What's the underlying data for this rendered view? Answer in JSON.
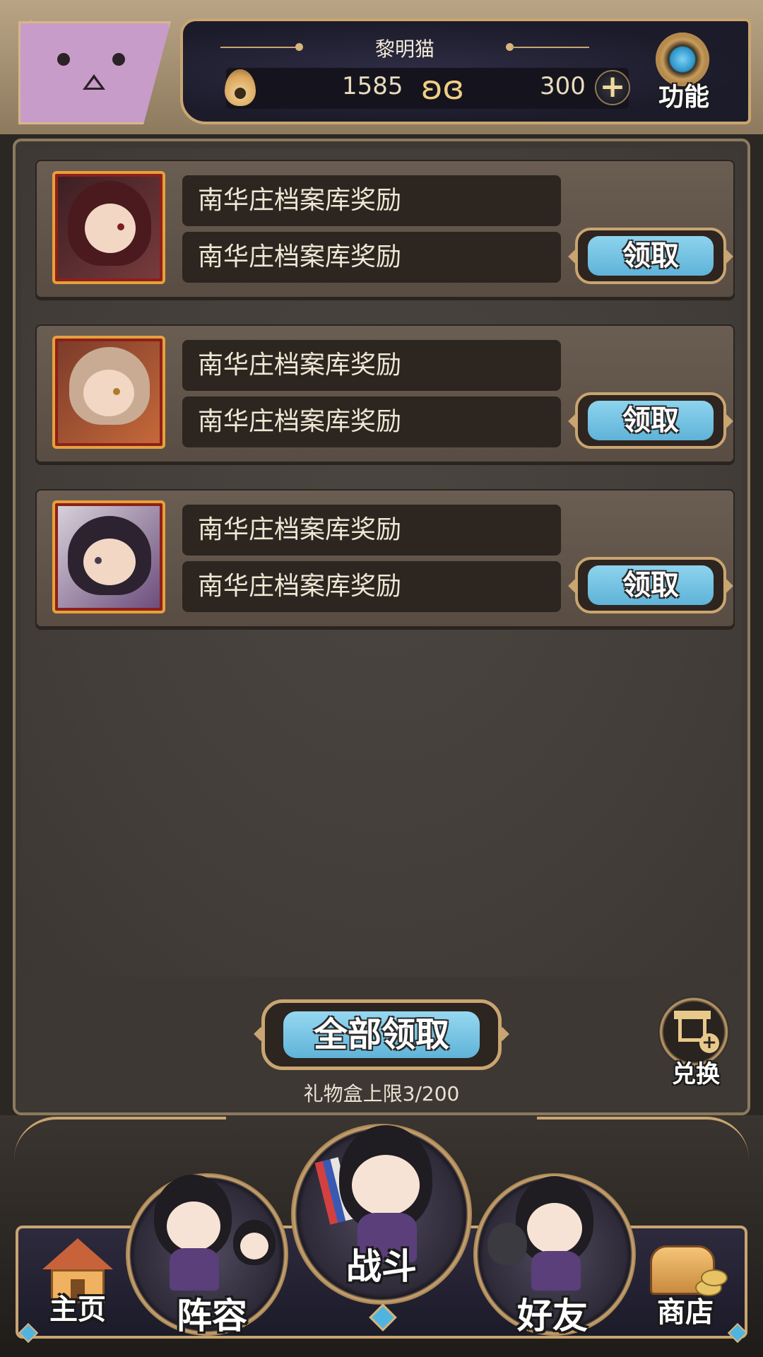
{
  "header": {
    "player_name": "黎明猫",
    "currency_primary": "1585",
    "currency_secondary": "300",
    "function_label": "功能",
    "icons": [
      "flame-icon",
      "butterfly-icon",
      "plus-icon",
      "gear-icon"
    ]
  },
  "rewards": [
    {
      "title": "南华庄档案库奖励",
      "desc": "南华庄档案库奖励",
      "claim_label": "领取"
    },
    {
      "title": "南华庄档案库奖励",
      "desc": "南华庄档案库奖励",
      "claim_label": "领取"
    },
    {
      "title": "南华庄档案库奖励",
      "desc": "南华庄档案库奖励",
      "claim_label": "领取"
    }
  ],
  "actions": {
    "claim_all_label": "全部领取",
    "box_limit_text": "礼物盒上限3/200",
    "exchange_label": "兑换"
  },
  "nav": {
    "home": "主页",
    "team": "阵容",
    "battle": "战斗",
    "friends": "好友",
    "shop": "商店"
  },
  "colors": {
    "accent_gold": "#c9a571",
    "button_blue": "#6fbfe0",
    "panel_brown": "#3d3833",
    "card_brown": "#645649",
    "avatar_pink": "#c89cc8"
  }
}
